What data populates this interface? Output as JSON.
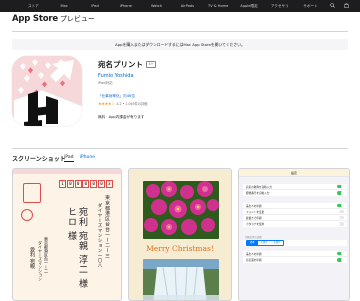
{
  "globalnav": {
    "items": [
      "ストア",
      "Mac",
      "iPad",
      "iPhone",
      "Watch",
      "AirPods",
      "TV & Home",
      "Apple限定",
      "アクセサリ",
      "サポート"
    ],
    "icons": [
      "apple-logo-icon",
      "search-icon",
      "bag-icon"
    ]
  },
  "header": {
    "brand": "App Store",
    "sub": "プレビュー"
  },
  "banner": {
    "text": "Appを購入またはダウンロードするにはMac App Storeを開いてください。"
  },
  "app": {
    "name": "宛名プリント",
    "age_rating": "4+",
    "developer": "Fumio Yoshida",
    "device": "iPad対応",
    "rank": "「仕事効率化」内46位",
    "stars": "★★★★☆",
    "rating_text": "4.2 • 1,063件の評価",
    "price": "無料 · App内課金が有ります"
  },
  "screenshots": {
    "title": "スクリーンショット",
    "tabs": [
      {
        "label": "iPad",
        "active": true
      },
      {
        "label": "iPhone",
        "active": false
      }
    ],
    "shot1": {
      "postal": [
        "1",
        "0",
        "0",
        "0",
        "0",
        "0",
        "3"
      ],
      "addr1": "東京都港区台台一ー二ー三",
      "addr2": "ダイヤーズマンション一〇八",
      "name1": "宛利 宛親 淳二 様",
      "name2": "ヒロ 様",
      "from1": "東京都港区台一ー二",
      "from2": "ダイヤーズマンション",
      "from3": "愛利 宛親"
    },
    "shot2": {
      "caption": "Merry Christmas!"
    },
    "shot3": {
      "nav_title": "設定",
      "groups": [
        {
          "rows": [
            {
              "label": "宛名の敬称を自動入力",
              "on": true
            },
            {
              "label": "郵便番号を自動入力",
              "on": true
            }
          ]
        },
        {
          "rows": [
            {
              "label": "差出人を印刷",
              "on": true
            },
            {
              "label": "フォントを変更",
              "on": false
            },
            {
              "label": "縦書きで印刷",
              "on": false
            },
            {
              "label": "カタカナを使用",
              "on": false
            }
          ]
        }
      ],
      "section_label": "印刷位置の調整",
      "seg": [
        "標準",
        "左寄せ",
        "右寄せ"
      ],
      "bottom_rows": [
        {
          "label": "差出人を印刷",
          "on": true
        },
        {
          "label": "宛名面を印刷",
          "on": true
        }
      ]
    }
  },
  "colors": {
    "accent": "#0066cc",
    "nav": "#1d1d1f",
    "star": "#ff9500",
    "icon_bg": "#f7d8da"
  }
}
